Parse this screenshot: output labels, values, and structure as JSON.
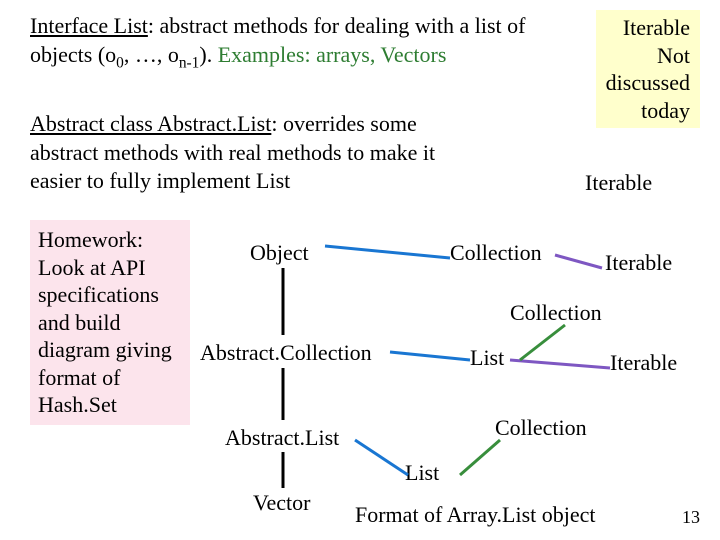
{
  "iterable_box": {
    "l1": "Iterable",
    "l2": "Not",
    "l3": "discussed",
    "l4": "today"
  },
  "para1": {
    "prefix": "Interface List",
    "rest1": ": abstract methods for dealing with a list of objects (o",
    "sub1": "0",
    "mid": ", …, o",
    "sub2": "n-1",
    "rest2": "). ",
    "green": "Examples: arrays, Vectors"
  },
  "para2": {
    "prefix": "Abstract class Abstract.List",
    "rest": ": overrides some abstract methods with real methods to make it easier to fully implement List"
  },
  "homework": {
    "l1": "Homework:",
    "l2": "Look at API",
    "l3": "specifications",
    "l4": "and build",
    "l5": "diagram giving",
    "l6": "format of",
    "l7": "Hash.Set"
  },
  "hierarchy": {
    "object": "Object",
    "abstract_collection": "Abstract.Collection",
    "abstract_list": "Abstract.List",
    "vector": "Vector"
  },
  "right_labels": {
    "iterable1": "Iterable",
    "collection1": "Collection",
    "iterable2": "Iterable",
    "collection2": "Collection",
    "list1": "List",
    "iterable3": "Iterable",
    "collection3": "Collection",
    "list2": "List"
  },
  "format_label": "Format of Array.List object",
  "page_num": "13"
}
